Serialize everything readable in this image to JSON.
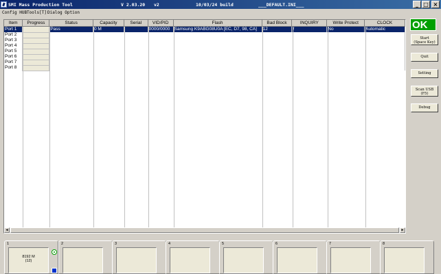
{
  "titlebar": {
    "app_name": "SMI Mass Production Tool",
    "version": "V 2.03.20",
    "variant": "v2",
    "build": "10/03/24 build",
    "ini": "___DEFAULT.INI___",
    "min_glyph": "_",
    "max_glyph": "□",
    "close_glyph": "×"
  },
  "menu": [
    "Config HUB",
    "Tools[T]",
    "Dialog Option"
  ],
  "table": {
    "headers": [
      "Item",
      "Progress",
      "Status",
      "Capacity",
      "Serial",
      "VID/PID",
      "Flash",
      "Bad Block",
      "INQUIRY",
      "Write Protect",
      "CLOCK"
    ],
    "rows": [
      {
        "item": "Port 1",
        "progress": "",
        "status": "Pass",
        "capacity": "0 M",
        "serial": "",
        "vidpid": "0000/0000",
        "flash": "Samsung K9ABG08U0A [EC, D7, 98, CA]",
        "badblock": "12",
        "inquiry": "/",
        "writeprotect": "No",
        "clock": "Automatic"
      },
      {
        "item": "Port 2"
      },
      {
        "item": "Port 3"
      },
      {
        "item": "Port 4"
      },
      {
        "item": "Port 5"
      },
      {
        "item": "Port 6"
      },
      {
        "item": "Port 7"
      },
      {
        "item": "Port 8"
      }
    ]
  },
  "scrollbar": {
    "left": "◄",
    "right": "►"
  },
  "side": {
    "ok": "OK",
    "start_line1": "Start",
    "start_line2": "(Space Key)",
    "quit": "Quit",
    "setting": "Setting",
    "scan_line1": "Scan USB",
    "scan_line2": "(F5)",
    "debug": "Debug"
  },
  "ports": [
    {
      "num": "1",
      "capacity": "8192 M",
      "sub": "(12)"
    },
    {
      "num": "2"
    },
    {
      "num": "3"
    },
    {
      "num": "4"
    },
    {
      "num": "5"
    },
    {
      "num": "6"
    },
    {
      "num": "7"
    },
    {
      "num": "8"
    }
  ],
  "colors": {
    "selection": "#0a246a",
    "ok_green": "#00a000",
    "led_blue": "#0033cc"
  }
}
